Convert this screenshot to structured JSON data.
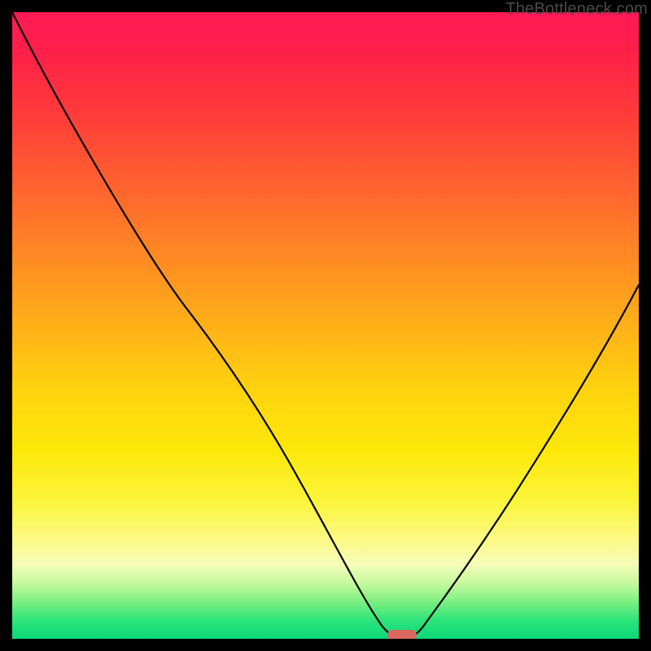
{
  "watermark": "TheBottleneck.com",
  "chart_data": {
    "type": "line",
    "title": "",
    "xlabel": "",
    "ylabel": "",
    "xlim": [
      0,
      100
    ],
    "ylim": [
      0,
      100
    ],
    "background_gradient": {
      "top": "#ff1a55",
      "middle": "#ffd20f",
      "bottom": "#0cd879"
    },
    "series": [
      {
        "name": "bottleneck-curve",
        "x": [
          0,
          3,
          8,
          15,
          22,
          27,
          33,
          40,
          46,
          52,
          56,
          59,
          61,
          62.5,
          64,
          66,
          70,
          76,
          83,
          90,
          97,
          100
        ],
        "y": [
          100,
          92,
          82,
          70,
          59,
          53,
          45,
          35,
          25,
          14,
          6,
          1.5,
          0.3,
          0.3,
          0.7,
          2,
          6,
          15,
          27,
          40,
          53,
          59
        ]
      }
    ],
    "marker": {
      "name": "min-marker",
      "x": 62,
      "y": 0.3,
      "width_pct": 4.2,
      "height_pct": 1.6,
      "color": "#d9685f"
    }
  }
}
